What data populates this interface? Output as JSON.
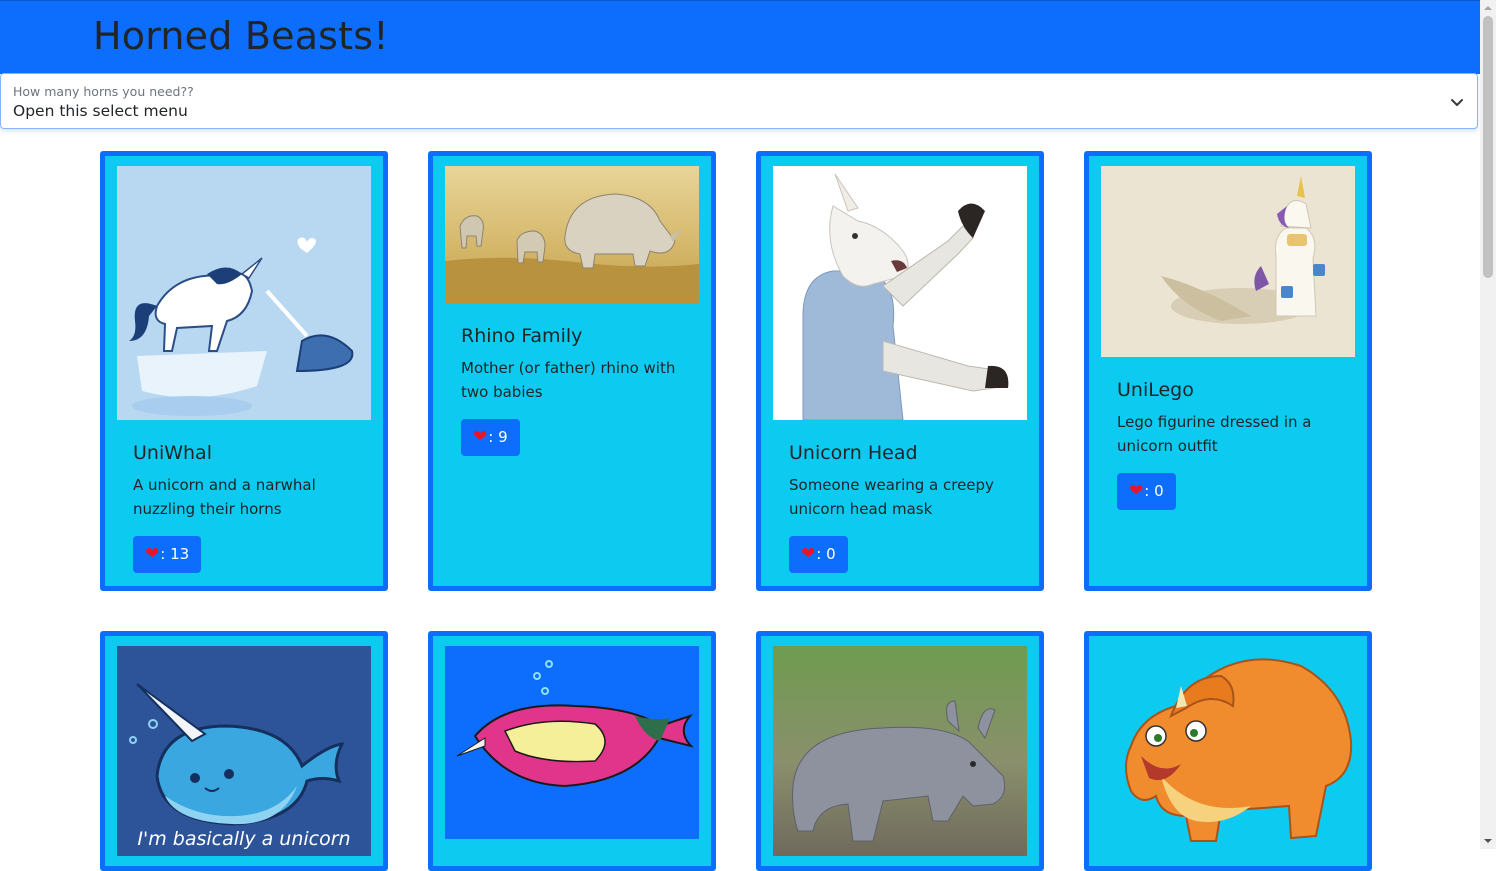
{
  "header": {
    "title": "Horned Beasts!"
  },
  "filter": {
    "label": "How many horns you need??",
    "value": "Open this select menu"
  },
  "cards_row1": [
    {
      "title": "UniWhal",
      "description": "A unicorn and a narwhal nuzzling their horns",
      "favorites": ": 13",
      "icon": "heart-icon"
    },
    {
      "title": "Rhino Family",
      "description": "Mother (or father) rhino with two babies",
      "favorites": ": 9",
      "icon": "heart-icon"
    },
    {
      "title": "Unicorn Head",
      "description": "Someone wearing a creepy unicorn head mask",
      "favorites": ": 0",
      "icon": "heart-icon"
    },
    {
      "title": "UniLego",
      "description": "Lego figurine dressed in a unicorn outfit",
      "favorites": ": 0",
      "icon": "heart-icon"
    }
  ],
  "cards_row2": [
    {
      "image_text": "I'm basically a unicorn"
    }
  ],
  "colors": {
    "primary": "#0d6efd",
    "card_bg": "#0dcaf0",
    "heart": "#e8152a"
  }
}
